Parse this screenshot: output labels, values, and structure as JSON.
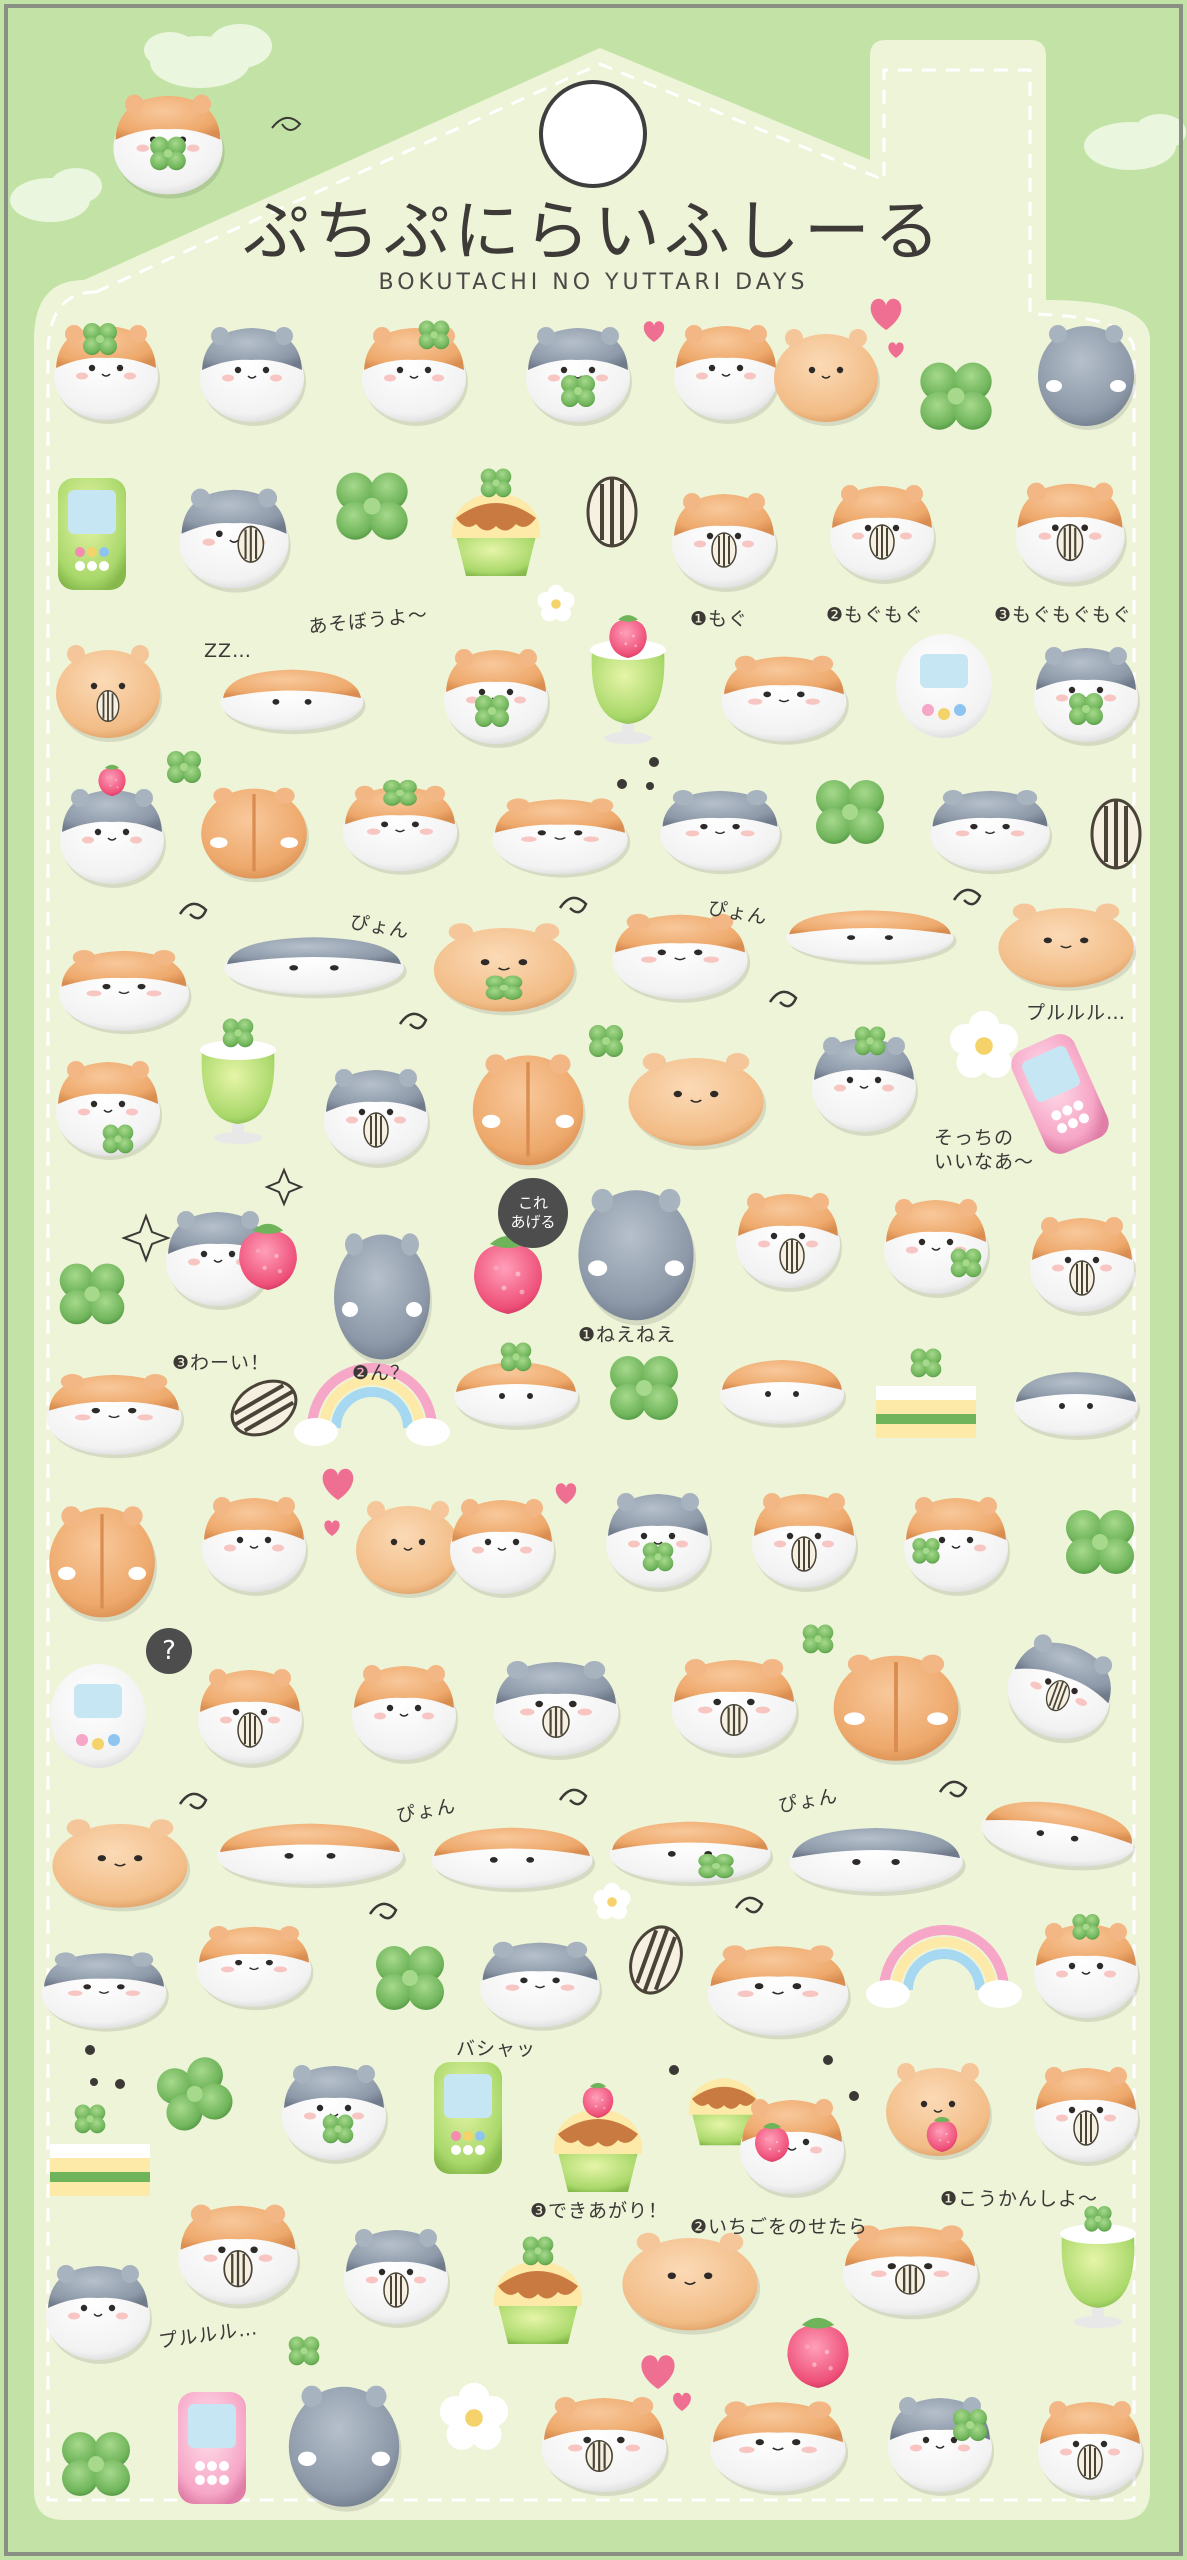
{
  "header": {
    "title": "ぷちぷにらいふしーる",
    "subtitle": "BOKUTACHI NO YUTTARI DAYS"
  },
  "labels": {
    "asobouyo": "あそぼうよ〜",
    "zzz": "ZZ…",
    "mogu1": "❶もぐ",
    "mogu2": "❷もぐもぐ",
    "mogu3": "❸もぐもぐもぐ",
    "pyon_a": "ぴょん",
    "pyon_b": "ぴょん",
    "pyon_c": "ぴょん",
    "pyon_d": "ぴょん",
    "pururu_top": "プルルル…",
    "socchino": "そっちの\nいいなあ〜",
    "korea": "これ\nあげる",
    "waai": "❸わーい！",
    "n": "❷ん？",
    "neenee": "❶ねえねえ",
    "pashaa": "バシャッ",
    "dekiagari": "❸できあがり！",
    "ichigo": "❷いちごをのせたら",
    "koukan": "❶こうかんしよ〜",
    "pururu_bottom": "プルルル…",
    "question": "?"
  },
  "colors": {
    "sheet_green": "#c3e3a6",
    "card_cream": "#eef4d8",
    "hamster_orange": "#eea96c",
    "hamster_gray": "#8d99a8",
    "hamster_white": "#ffffff",
    "clover_green": "#6fb45a",
    "heart_pink": "#ee6f92"
  }
}
